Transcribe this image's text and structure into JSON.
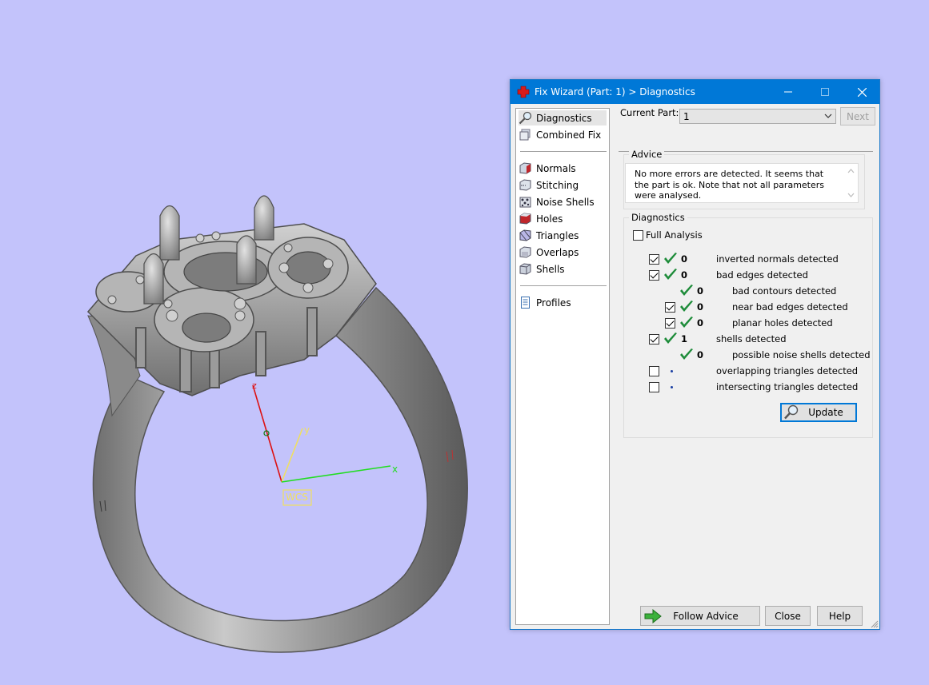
{
  "viewport": {
    "axis_labels": {
      "z": "z",
      "y": "y",
      "x": "x"
    },
    "wcs_label": "WCS",
    "colors": {
      "background": "#c3c3fb",
      "x_axis": "#22dd22",
      "y_axis": "#f0e060",
      "z_axis": "#dd1111"
    }
  },
  "dialog": {
    "title": "Fix Wizard (Part: 1) > Diagnostics",
    "nav": {
      "top_items": [
        {
          "label": "Diagnostics",
          "icon": "magnifier-icon",
          "selected": true
        },
        {
          "label": "Combined Fix",
          "icon": "cube-stack-icon"
        }
      ],
      "tool_items": [
        {
          "label": "Normals",
          "icon": "normals-cube-icon"
        },
        {
          "label": "Stitching",
          "icon": "stitching-cube-icon"
        },
        {
          "label": "Noise Shells",
          "icon": "noise-shells-icon"
        },
        {
          "label": "Holes",
          "icon": "holes-cube-icon"
        },
        {
          "label": "Triangles",
          "icon": "triangles-cube-icon"
        },
        {
          "label": "Overlaps",
          "icon": "overlaps-cube-icon"
        },
        {
          "label": "Shells",
          "icon": "shells-cube-icon"
        }
      ],
      "bottom_items": [
        {
          "label": "Profiles",
          "icon": "document-icon"
        }
      ]
    },
    "current_part": {
      "label": "Current Part:",
      "value": "1"
    },
    "next_label": "Next",
    "advice": {
      "group_label": "Advice",
      "text": "No more errors are detected. It seems that the part is ok. Note that not all parameters were analysed."
    },
    "diagnostics": {
      "group_label": "Diagnostics",
      "full_analysis_label": "Full Analysis",
      "full_analysis_checked": false,
      "rows": [
        {
          "checked": true,
          "has_checkbox": true,
          "indent": 0,
          "status": "ok",
          "count": "0",
          "text": "inverted normals detected"
        },
        {
          "checked": true,
          "has_checkbox": true,
          "indent": 0,
          "status": "ok",
          "count": "0",
          "text": "bad edges detected"
        },
        {
          "checked": false,
          "has_checkbox": false,
          "indent": 1,
          "status": "ok",
          "count": "0",
          "text": "bad contours detected"
        },
        {
          "checked": true,
          "has_checkbox": true,
          "indent": 1,
          "status": "ok",
          "count": "0",
          "text": "near bad edges detected"
        },
        {
          "checked": true,
          "has_checkbox": true,
          "indent": 1,
          "status": "ok",
          "count": "0",
          "text": "planar holes detected"
        },
        {
          "checked": true,
          "has_checkbox": true,
          "indent": 0,
          "status": "ok",
          "count": "1",
          "text": "shells detected"
        },
        {
          "checked": false,
          "has_checkbox": false,
          "indent": 1,
          "status": "ok",
          "count": "0",
          "text": "possible noise shells detected"
        },
        {
          "checked": false,
          "has_checkbox": true,
          "indent": 0,
          "status": "skipped",
          "count": "",
          "text": "overlapping triangles detected"
        },
        {
          "checked": false,
          "has_checkbox": true,
          "indent": 0,
          "status": "skipped",
          "count": "",
          "text": "intersecting triangles detected"
        }
      ],
      "update_label": "Update"
    },
    "buttons": {
      "follow_advice": "Follow Advice",
      "close": "Close",
      "help": "Help"
    },
    "colors": {
      "titlebar": "#0078d7",
      "check_green": "#1e8c3a",
      "accent": "#0078d7"
    }
  }
}
